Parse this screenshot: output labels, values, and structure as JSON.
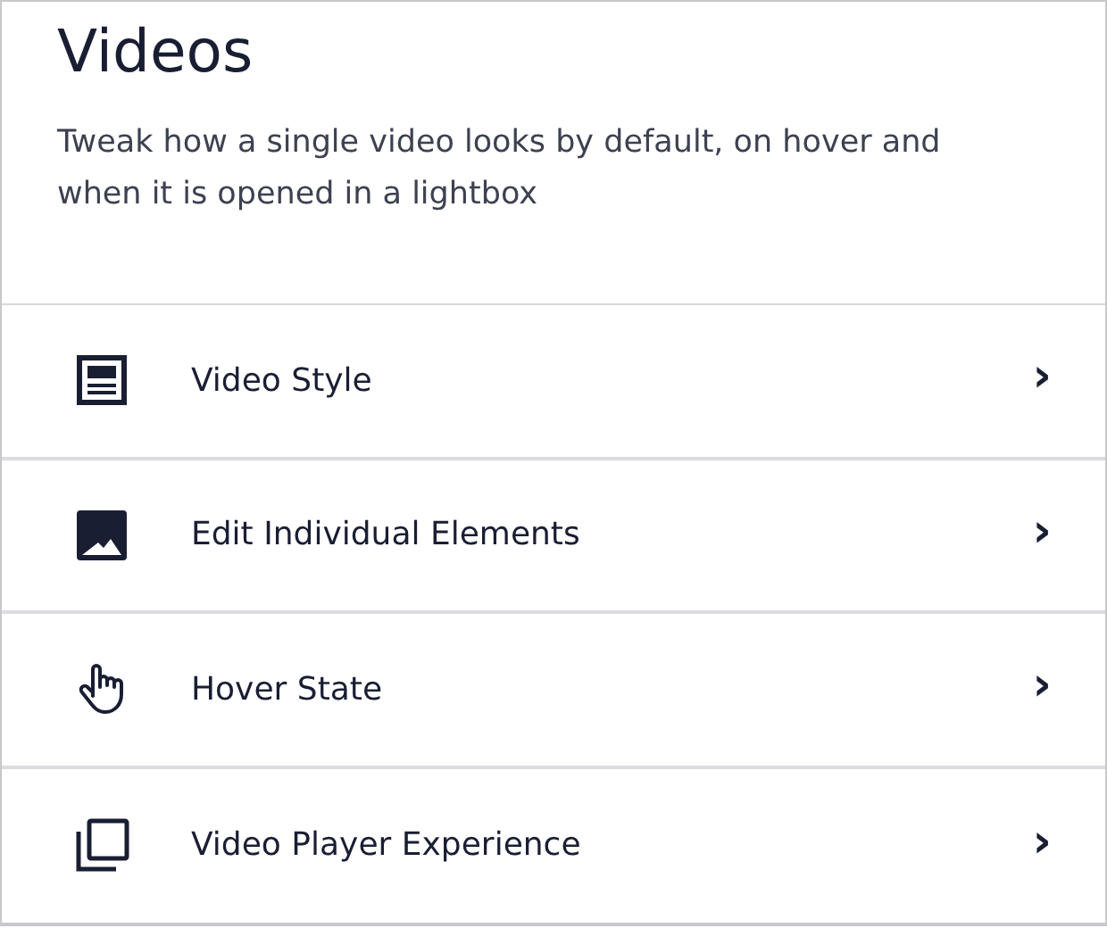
{
  "header": {
    "title": "Videos",
    "description": "Tweak how a single video looks by default, on hover and when it is opened in a lightbox"
  },
  "items": [
    {
      "label": "Video Style",
      "chevron": "›"
    },
    {
      "label": "Edit Individual Elements",
      "chevron": "›"
    },
    {
      "label": "Hover State",
      "chevron": "›"
    },
    {
      "label": "Video Player Experience",
      "chevron": "›"
    }
  ]
}
